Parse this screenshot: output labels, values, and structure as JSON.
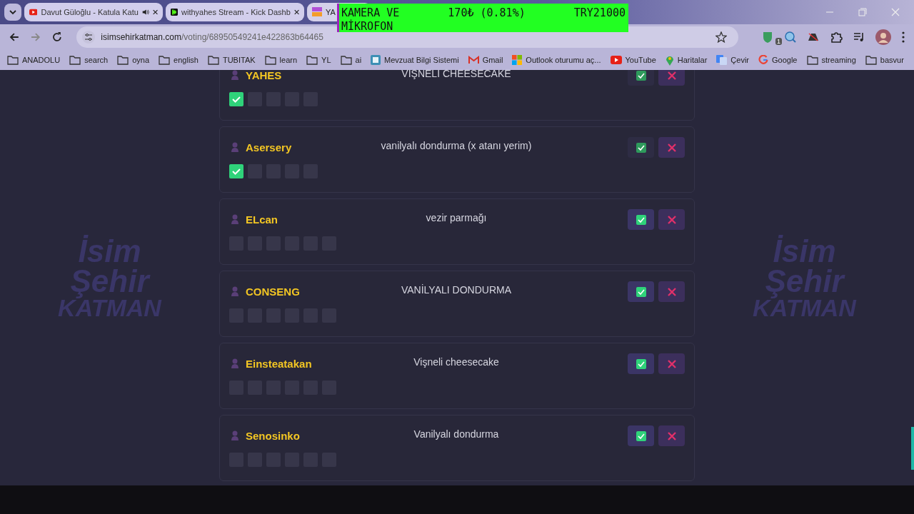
{
  "tabs": [
    {
      "title": "Davut Güloğlu - Katula Katu",
      "kind": "youtube",
      "audio": true,
      "selected": false
    },
    {
      "title": "withyahes Stream - Kick Dashb",
      "kind": "kick",
      "audio": false,
      "selected": false
    },
    {
      "title": "YA",
      "kind": "site",
      "audio": false,
      "selected": true
    }
  ],
  "overlay": {
    "label_lines": [
      "KAMERA VE",
      "MİKROFON"
    ],
    "amount": "170₺ (0.81%)",
    "goal": "TRY21000"
  },
  "address_bar": {
    "domain": "isimsehirkatman.com",
    "path": "/voting/68950549241e422863b64465"
  },
  "extension_badge": "1",
  "bookmarks": [
    {
      "label": "ANADOLU",
      "kind": "folder"
    },
    {
      "label": "search",
      "kind": "folder"
    },
    {
      "label": "oyna",
      "kind": "folder"
    },
    {
      "label": "english",
      "kind": "folder"
    },
    {
      "label": "TUBITAK",
      "kind": "folder"
    },
    {
      "label": "learn",
      "kind": "folder"
    },
    {
      "label": "YL",
      "kind": "folder"
    },
    {
      "label": "ai",
      "kind": "folder"
    },
    {
      "label": "Mevzuat Bilgi Sistemi",
      "kind": "mevzuat"
    },
    {
      "label": "Gmail",
      "kind": "gmail"
    },
    {
      "label": "Outlook oturumu aç...",
      "kind": "outlook"
    },
    {
      "label": "YouTube",
      "kind": "youtube"
    },
    {
      "label": "Haritalar",
      "kind": "maps"
    },
    {
      "label": "Çevir",
      "kind": "translate"
    },
    {
      "label": "Google",
      "kind": "google"
    },
    {
      "label": "streaming",
      "kind": "folder"
    },
    {
      "label": "basvur",
      "kind": "folder"
    }
  ],
  "background_logos": [
    [
      "İsim",
      "Şehir",
      "KATMAN"
    ],
    [
      "İsim",
      "Şehir",
      "KATMAN"
    ]
  ],
  "answers": [
    {
      "player": "YAHES",
      "answer": "VIŞNELI CHEESECAKE",
      "voted": true,
      "votes": [
        {
          "checked": true
        },
        {
          "checked": false
        },
        {
          "checked": false
        },
        {
          "checked": false
        },
        {
          "checked": false
        }
      ]
    },
    {
      "player": "Asersery",
      "answer": "vanilyalı dondurma (x atanı yerim)",
      "voted": true,
      "votes": [
        {
          "checked": true
        },
        {
          "checked": false
        },
        {
          "checked": false
        },
        {
          "checked": false
        },
        {
          "checked": false
        }
      ]
    },
    {
      "player": "ELcan",
      "answer": "vezir parmağı",
      "voted": false,
      "votes": [
        {
          "checked": false
        },
        {
          "checked": false
        },
        {
          "checked": false
        },
        {
          "checked": false
        },
        {
          "checked": false
        },
        {
          "checked": false
        }
      ]
    },
    {
      "player": "CONSENG",
      "answer": "VANİLYALI DONDURMA",
      "voted": false,
      "votes": [
        {
          "checked": false
        },
        {
          "checked": false
        },
        {
          "checked": false
        },
        {
          "checked": false
        },
        {
          "checked": false
        },
        {
          "checked": false
        }
      ]
    },
    {
      "player": "Einsteatakan",
      "answer": "Vişneli cheesecake",
      "voted": false,
      "votes": [
        {
          "checked": false
        },
        {
          "checked": false
        },
        {
          "checked": false
        },
        {
          "checked": false
        },
        {
          "checked": false
        },
        {
          "checked": false
        }
      ]
    },
    {
      "player": "Senosinko",
      "answer": "Vanilyalı dondurma",
      "voted": false,
      "votes": [
        {
          "checked": false
        },
        {
          "checked": false
        },
        {
          "checked": false
        },
        {
          "checked": false
        },
        {
          "checked": false
        },
        {
          "checked": false
        }
      ]
    }
  ]
}
